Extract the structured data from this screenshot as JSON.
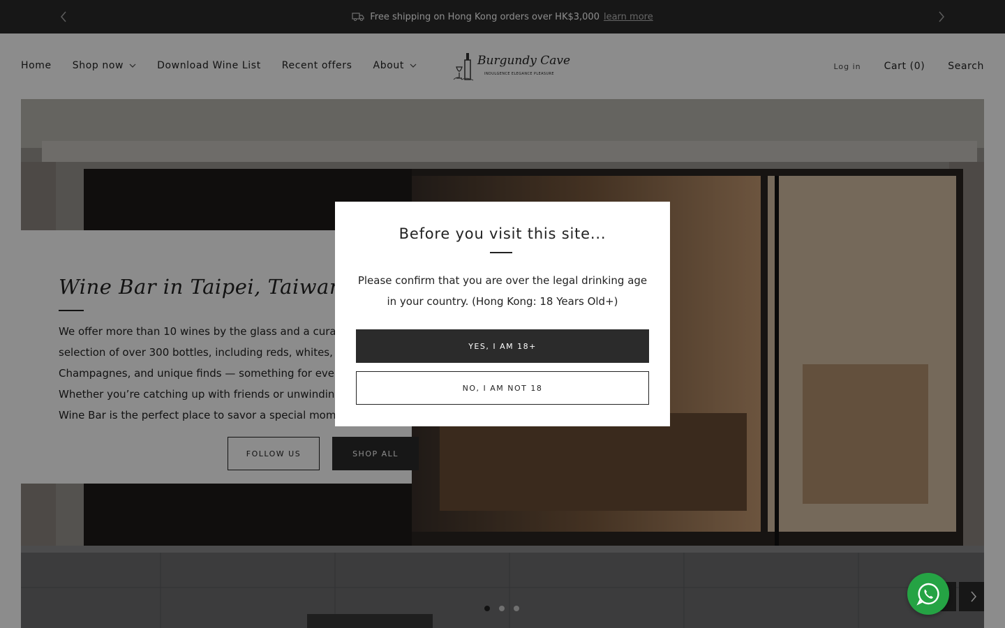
{
  "announcement": {
    "text": "Free shipping on Hong Kong orders over HK$3,000",
    "link": "learn more"
  },
  "nav": {
    "items": [
      {
        "label": "Home"
      },
      {
        "label": "Shop now"
      },
      {
        "label": "Download Wine List"
      },
      {
        "label": "Recent offers"
      },
      {
        "label": "About"
      }
    ]
  },
  "logo": {
    "name": "Burgundy Cave",
    "tagline": "INDULGENCE ELEGANCE PLEASURE"
  },
  "header_right": {
    "login": "Log in",
    "cart": "Cart (0)",
    "search": "Search"
  },
  "hero": {
    "title": "Wine Bar in Taipei, Taiwan",
    "body_lines": [
      "We offer more than 10 wines by the glass and a curated",
      "selection of over 300 bottles, including reds, whites,",
      "Champagnes, and unique finds — something for every ta",
      "Whether you’re catching up with friends or unwinding so",
      "Wine Bar is the perfect place to savor a special moment"
    ],
    "follow_button": "FOLLOW US",
    "shop_button": "SHOP ALL"
  },
  "age_modal": {
    "title": "Before you visit this site...",
    "text": "Please confirm that you are over the legal drinking age in your country. (Hong Kong: 18 Years Old+)",
    "yes_button": "YES, I AM 18+",
    "no_button": "NO, I AM NOT 18"
  },
  "colors": {
    "dark": "#2b2b2b",
    "whatsapp": "#25a344"
  }
}
